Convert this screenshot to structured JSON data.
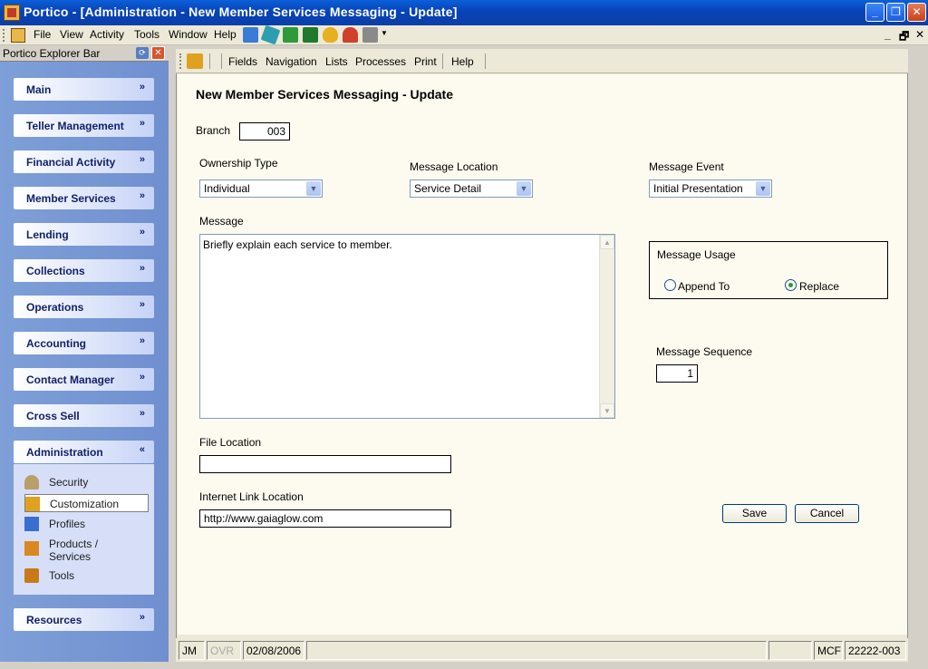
{
  "window": {
    "title": "Portico - [Administration - New Member Services Messaging - Update]",
    "min_glyph": "_",
    "max_glyph": "❐",
    "close_glyph": "✕"
  },
  "menubar": {
    "items": [
      "File",
      "View",
      "Activity",
      "Tools",
      "Window",
      "Help"
    ],
    "mdi_controls": [
      "_",
      "🗗",
      "✕"
    ]
  },
  "explorer": {
    "title": "Portico Explorer Bar",
    "groups": [
      {
        "label": "Main",
        "chevron": "»"
      },
      {
        "label": "Teller Management",
        "chevron": "»"
      },
      {
        "label": "Financial Activity",
        "chevron": "»"
      },
      {
        "label": "Member Services",
        "chevron": "»"
      },
      {
        "label": "Lending",
        "chevron": "»"
      },
      {
        "label": "Collections",
        "chevron": "»"
      },
      {
        "label": "Operations",
        "chevron": "»"
      },
      {
        "label": "Accounting",
        "chevron": "»"
      },
      {
        "label": "Contact Manager",
        "chevron": "»"
      },
      {
        "label": "Cross Sell",
        "chevron": "»"
      },
      {
        "label": "Administration",
        "chevron": "«"
      },
      {
        "label": "Resources",
        "chevron": "»"
      }
    ],
    "admin_items": [
      {
        "label": "Security",
        "icon": "keys-icon"
      },
      {
        "label": "Customization",
        "icon": "customization-icon"
      },
      {
        "label": "Profiles",
        "icon": "profiles-icon"
      },
      {
        "label": "Products /",
        "label2": "Services",
        "icon": "products-icon"
      },
      {
        "label": "Tools",
        "icon": "tools-icon"
      }
    ]
  },
  "inner_toolbar": {
    "items": [
      "Fields",
      "Navigation",
      "Lists",
      "Processes",
      "Print",
      "Help"
    ]
  },
  "form": {
    "title": "New Member Services Messaging - Update",
    "branch_label": "Branch",
    "branch_value": "003",
    "ownership_label": "Ownership Type",
    "ownership_value": "Individual",
    "location_label": "Message Location",
    "location_value": "Service Detail",
    "event_label": "Message Event",
    "event_value": "Initial Presentation",
    "message_label": "Message",
    "message_value": "Briefly explain each service to member.",
    "usage_label": "Message Usage",
    "usage_options": [
      "Append To",
      "Replace"
    ],
    "usage_selected": "Replace",
    "sequence_label": "Message Sequence",
    "sequence_value": "1",
    "file_location_label": "File Location",
    "file_location_value": "",
    "link_label": "Internet Link Location",
    "link_value": "http://www.gaiaglow.com",
    "save_label": "Save",
    "cancel_label": "Cancel"
  },
  "status": {
    "user": "JM",
    "ovr": "OVR",
    "date": "02/08/2006",
    "mode": "MCF",
    "account": "22222-003"
  },
  "colors": {
    "title_bar": "#0843b7",
    "explorer_bg": "#7f9fd8",
    "form_bg": "#fdfbf0",
    "group_text": "#12226b"
  }
}
